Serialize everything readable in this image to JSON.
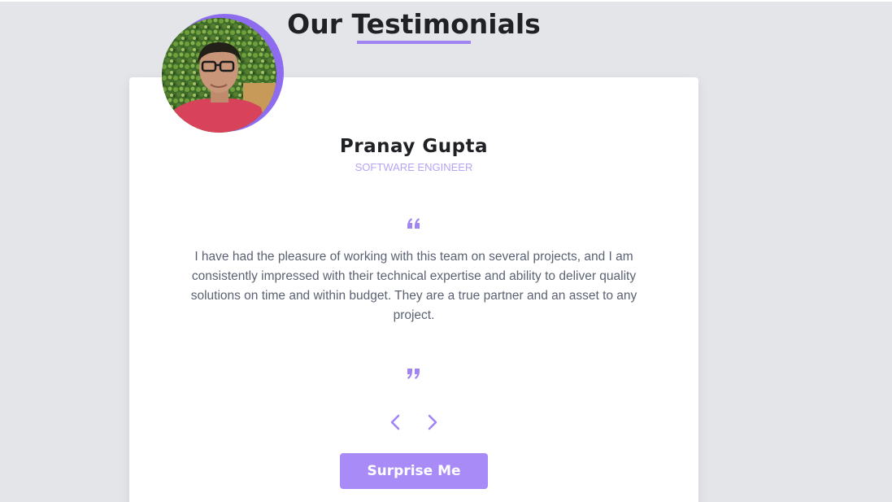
{
  "header": {
    "title": "Our Testimonials"
  },
  "testimonial": {
    "name": "Pranay Gupta",
    "job": "SOFTWARE ENGINEER",
    "text": "I have had the pleasure of working with this team on several projects, and I am consistently impressed with their technical expertise and ability to deliver quality solutions on time and within budget. They are a true partner and an asset to any project.",
    "quote_open_icon": "quote-left-icon",
    "quote_close_icon": "quote-right-icon"
  },
  "controls": {
    "prev_icon": "chevron-left-icon",
    "next_icon": "chevron-right-icon",
    "random_label": "Surprise Me"
  },
  "colors": {
    "accent": "#a98bf7",
    "accent_dark": "#8e6cf0",
    "background": "#e4e5e9",
    "card": "#ffffff",
    "title": "#1f2125",
    "job": "#b7a3f5",
    "body_text": "#5b6272"
  }
}
